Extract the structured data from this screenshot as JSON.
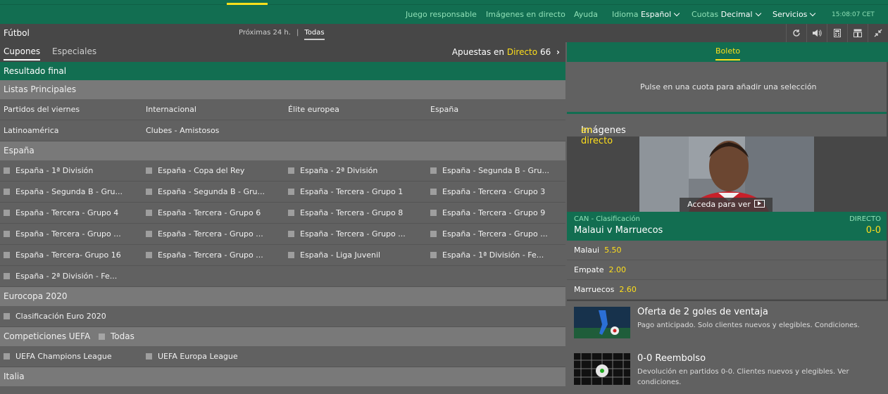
{
  "topnav": {
    "juego": "Juego responsable",
    "imagenes": "Imágenes en directo",
    "ayuda": "Ayuda",
    "idioma_label": "Idioma",
    "idioma_value": "Español",
    "cuotas_label": "Cuotas",
    "cuotas_value": "Decimal",
    "servicios": "Servicios",
    "time": "15:08:07 CET"
  },
  "subbar": {
    "title": "Fútbol",
    "tab1": "Próximas 24 h.",
    "tab2": "Todas",
    "separator": "|"
  },
  "tabs": {
    "cupones": "Cupones",
    "especiales": "Especiales",
    "apuestas_en": "Apuestas en",
    "directo": "Directo",
    "count": "66",
    "arrow": "›"
  },
  "green_header": "Resultado final",
  "sections": {
    "listas": "Listas Principales",
    "espana": "España",
    "eurocopa": "Eurocopa 2020",
    "uefa": "Competiciones UEFA",
    "uefa_todas": "Todas",
    "italia": "Italia"
  },
  "listas_rows": [
    [
      "Partidos del viernes",
      "Internacional",
      "Élite europea",
      "España"
    ],
    [
      "Latinoamérica",
      "Clubes - Amistosos"
    ]
  ],
  "espana_rows": [
    [
      "España - 1ª División",
      "España - Copa del Rey",
      "España - 2ª División",
      "España - Segunda B - Gru..."
    ],
    [
      "España - Segunda B - Gru...",
      "España - Segunda B - Gru...",
      "España - Tercera - Grupo 1",
      "España - Tercera - Grupo 3"
    ],
    [
      "España - Tercera - Grupo 4",
      "España - Tercera - Grupo 6",
      "España - Tercera - Grupo 8",
      "España - Tercera - Grupo 9"
    ],
    [
      "España - Tercera - Grupo ...",
      "España - Tercera - Grupo ...",
      "España - Tercera - Grupo ...",
      "España - Tercera - Grupo ..."
    ],
    [
      "España - Tercera- Grupo 16",
      "España - Tercera - Grupo ...",
      "España - Liga Juvenil",
      "España - 1ª División - Fe..."
    ],
    [
      "España - 2ª División - Fe..."
    ]
  ],
  "eurocopa_rows": [
    [
      "Clasificación Euro 2020"
    ]
  ],
  "uefa_rows": [
    [
      "UEFA Champions League",
      "UEFA Europa League"
    ]
  ],
  "boleto": {
    "tab": "Boleto",
    "empty": "Pulse en una cuota para añadir una selección"
  },
  "imagenes": {
    "label": "Imágenes",
    "accent": "en directo",
    "acceda": "Acceda para ver"
  },
  "match": {
    "category": "CAN - Clasificación",
    "status": "DIRECTO",
    "teams": "Malaui v Marruecos",
    "score": "0-0"
  },
  "odds": [
    {
      "name": "Malaui",
      "price": "5.50"
    },
    {
      "name": "Empate",
      "price": "2.00"
    },
    {
      "name": "Marruecos",
      "price": "2.60"
    }
  ],
  "promos": [
    {
      "title": "Oferta de 2 goles de ventaja",
      "desc": "Pago anticipado. Solo clientes nuevos y elegibles. Condiciones."
    },
    {
      "title": "0-0 Reembolso",
      "desc": "Devolución en partidos 0-0. Clientes nuevos y elegibles. Ver condiciones."
    }
  ],
  "colors": {
    "brand_green": "#126e51",
    "accent_yellow": "#ffdf1b",
    "panel_gray": "#616161",
    "dark_gray": "#474747"
  }
}
